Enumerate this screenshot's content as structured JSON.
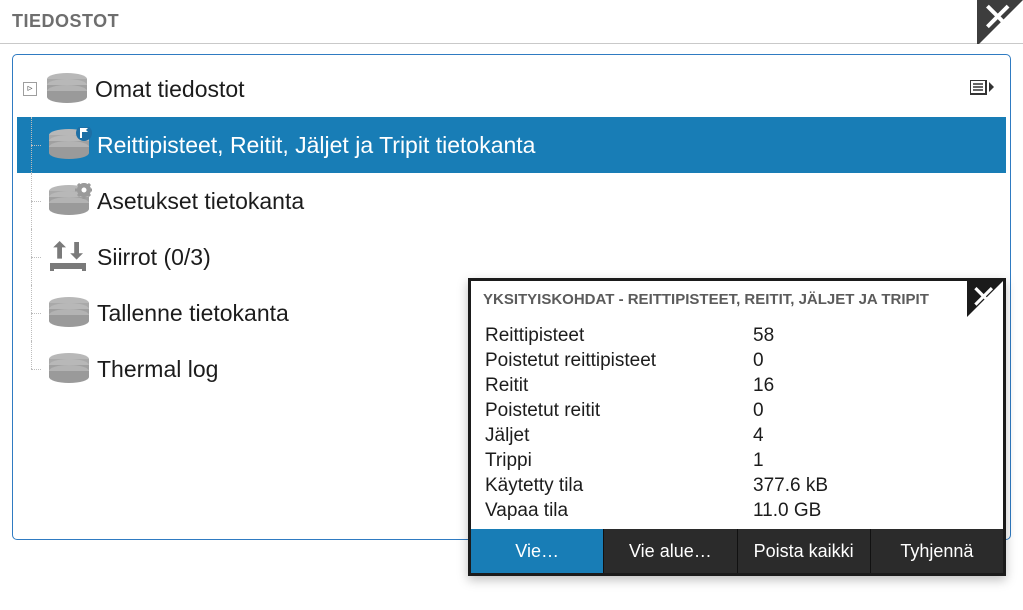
{
  "window": {
    "title": "TIEDOSTOT"
  },
  "tree": {
    "items": [
      {
        "label": "Omat tiedostot",
        "icon": "db",
        "expandable": true,
        "action_icon": "list-chevron"
      },
      {
        "label": "Reittipisteet, Reitit, Jäljet ja Tripit tietokanta",
        "icon": "db-flag",
        "selected": true
      },
      {
        "label": "Asetukset tietokanta",
        "icon": "db-gear"
      },
      {
        "label": "Siirrot (0/3)",
        "icon": "transfer"
      },
      {
        "label": "Tallenne tietokanta",
        "icon": "db"
      },
      {
        "label": "Thermal log",
        "icon": "db"
      }
    ]
  },
  "details": {
    "title": "YKSITYISKOHDAT - REITTIPISTEET, REITIT, JÄLJET JA TRIPIT",
    "rows": [
      {
        "k": "Reittipisteet",
        "v": "58"
      },
      {
        "k": "Poistetut reittipisteet",
        "v": "0"
      },
      {
        "k": "Reitit",
        "v": "16"
      },
      {
        "k": "Poistetut reitit",
        "v": "0"
      },
      {
        "k": "Jäljet",
        "v": "4"
      },
      {
        "k": "Trippi",
        "v": "1"
      },
      {
        "k": "Käytetty tila",
        "v": "377.6 kB"
      },
      {
        "k": "Vapaa tila",
        "v": "11.0 GB"
      }
    ],
    "buttons": {
      "export": "Vie…",
      "export_region": "Vie alue…",
      "delete_all": "Poista kaikki",
      "purge": "Tyhjennä"
    }
  }
}
